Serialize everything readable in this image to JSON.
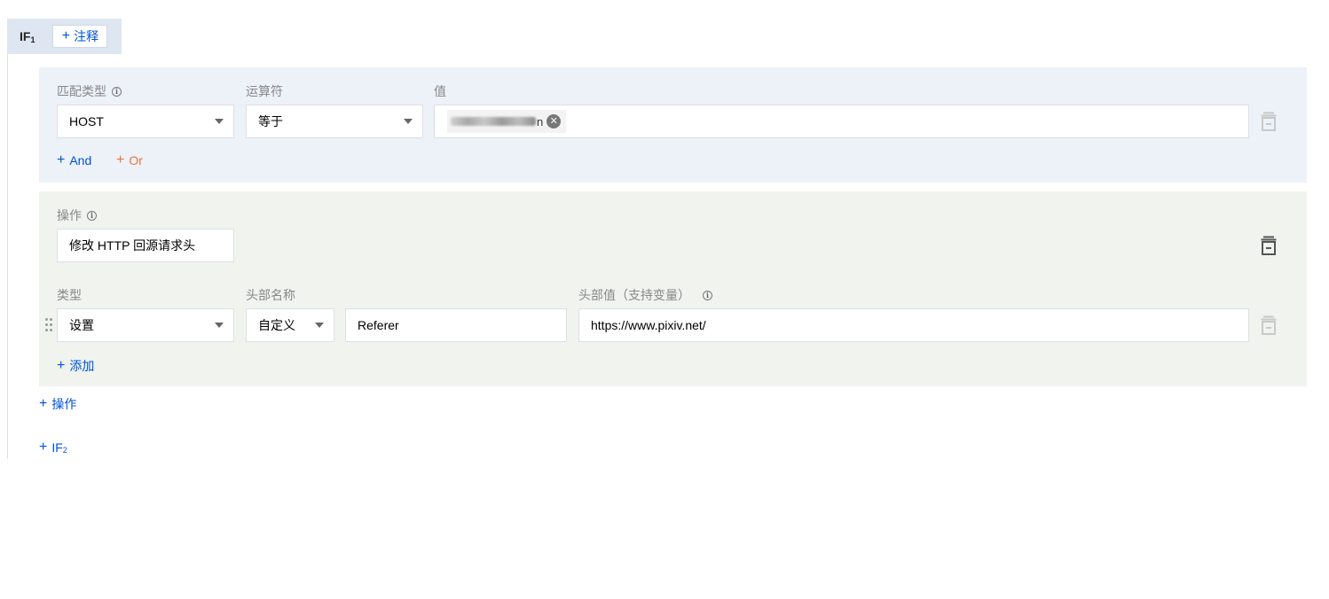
{
  "if_block": {
    "label": "IF",
    "index": "1",
    "note_button": "注释"
  },
  "condition": {
    "match_type_label": "匹配类型",
    "match_type_value": "HOST",
    "operator_label": "运算符",
    "operator_value": "等于",
    "value_label": "值",
    "value_tag_tail": "n",
    "and_label": "And",
    "or_label": "Or"
  },
  "action": {
    "operation_label": "操作",
    "operation_value": "修改 HTTP 回源请求头",
    "type_label": "类型",
    "type_value": "设置",
    "header_name_label": "头部名称",
    "header_name_mode": "自定义",
    "header_name_value": "Referer",
    "header_value_label": "头部值（支持变量）",
    "header_value_value": "https://www.pixiv.net/",
    "add_label": "添加"
  },
  "footer": {
    "add_operation_label": "操作",
    "add_if_label": "IF",
    "add_if_index": "2"
  },
  "colors": {
    "accent": "#0052d9",
    "or": "#e8743b",
    "condition_bg": "#edf1f8",
    "action_bg": "#f0f3ee",
    "header_bg": "#dee6f1"
  }
}
